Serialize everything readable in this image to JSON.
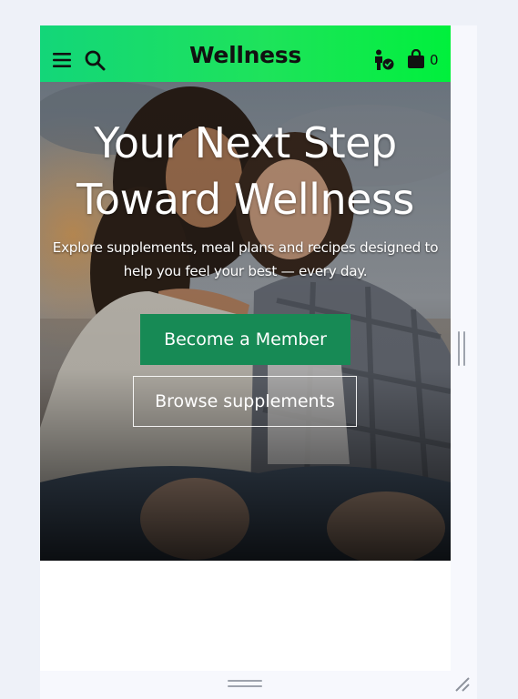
{
  "header": {
    "brand": "Wellness",
    "cart_count": "0",
    "icons": [
      "menu-icon",
      "search-icon",
      "account-verified-icon",
      "shopping-bag-icon"
    ],
    "gradient_colors": [
      "#13d679",
      "#00f03c"
    ]
  },
  "hero": {
    "title_line1": "Your Next Step",
    "title_line2": "Toward Wellness",
    "subtitle_line1": "Explore supplements, meal plans and recipes designed to",
    "subtitle_line2": "help you feel your best — every day.",
    "primary_button": "Become a Member",
    "secondary_button": "Browse supplements",
    "primary_color": "#178a55"
  }
}
